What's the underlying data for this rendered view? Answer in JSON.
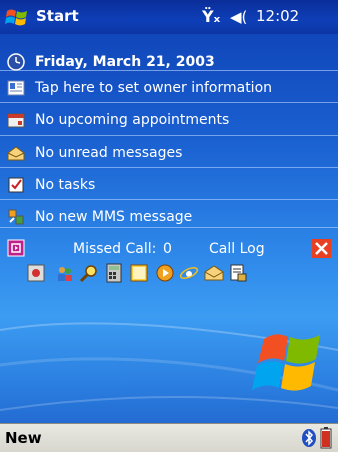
{
  "titlebar": {
    "app_title": "Start",
    "time": "12:02",
    "antenna_glyph": "Ÿₓ",
    "speaker_glyph": "◀(",
    "icons": [
      "windows-flag-icon",
      "no-signal-antenna-icon",
      "speaker-icon"
    ]
  },
  "today": {
    "date": "Friday, March 21, 2003",
    "owner": "Tap here to set owner information",
    "appointments": "No upcoming appointments",
    "messages": "No unread messages",
    "tasks": "No tasks",
    "mms": "No new MMS message"
  },
  "call_plugin": {
    "missed_label": "Missed Call:",
    "missed_count": "0",
    "call_log_label": "Call Log"
  },
  "quick_launch": [
    "app-icon",
    "contacts-icon",
    "search-icon",
    "calculator-icon",
    "notes-icon",
    "media-player-icon",
    "internet-explorer-icon",
    "inbox-icon",
    "file-explorer-icon"
  ],
  "menubar": {
    "left_softkey": "New",
    "icons": [
      "bluetooth-icon",
      "battery-icon"
    ]
  },
  "colors": {
    "titlebar": "#0c35a4",
    "background": "#1a5fd0",
    "close_button": "#e84020",
    "menubar": "#d7d5cc"
  }
}
